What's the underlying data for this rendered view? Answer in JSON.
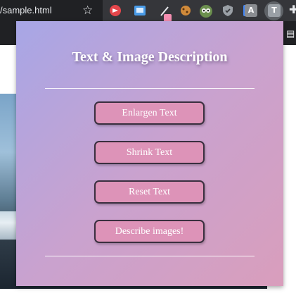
{
  "browser": {
    "url_text": "/sample.html",
    "extension_letter_a": "A",
    "extension_letter_t": "T"
  },
  "popup": {
    "title": "Text & Image Description",
    "buttons": {
      "enlarge": "Enlargen Text",
      "shrink": "Shrink Text",
      "reset": "Reset Text",
      "describe": "Describe images!"
    }
  }
}
